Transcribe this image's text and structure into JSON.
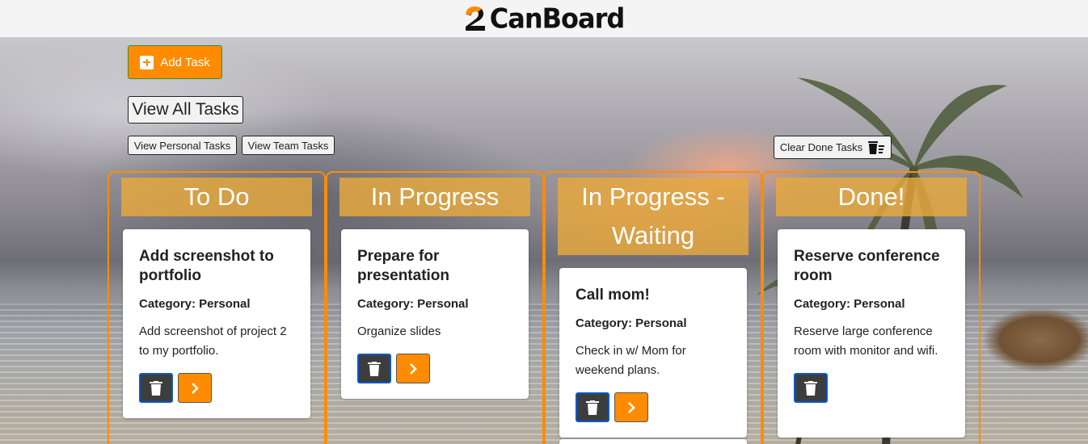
{
  "app": {
    "name": "CanBoard",
    "accent": "#ff8c00"
  },
  "toolbar": {
    "add_task": "Add Task",
    "view_all": "View All Tasks",
    "view_personal": "View Personal Tasks",
    "view_team": "View Team Tasks",
    "clear_done": "Clear Done Tasks"
  },
  "icons": {
    "add": "plus-square-icon",
    "delete": "trash-icon",
    "next": "chevron-right-icon",
    "clear": "trash-list-icon"
  },
  "columns": [
    {
      "title": "To Do",
      "cards": [
        {
          "title": "Add screenshot to portfolio",
          "category": "Category: Personal",
          "description": "Add screenshot of project 2 to my portfolio."
        }
      ]
    },
    {
      "title": "In Progress",
      "cards": [
        {
          "title": "Prepare for presentation",
          "category": "Category: Personal",
          "description": "Organize slides"
        }
      ]
    },
    {
      "title": "In Progress - Waiting",
      "cards": [
        {
          "title": "Call mom!",
          "category": "Category: Personal",
          "description": "Check in w/ Mom for weekend plans."
        }
      ]
    },
    {
      "title": "Done!",
      "cards": [
        {
          "title": "Reserve conference room",
          "category": "Category: Personal",
          "description": "Reserve large conference room with monitor and wifi."
        }
      ]
    }
  ]
}
